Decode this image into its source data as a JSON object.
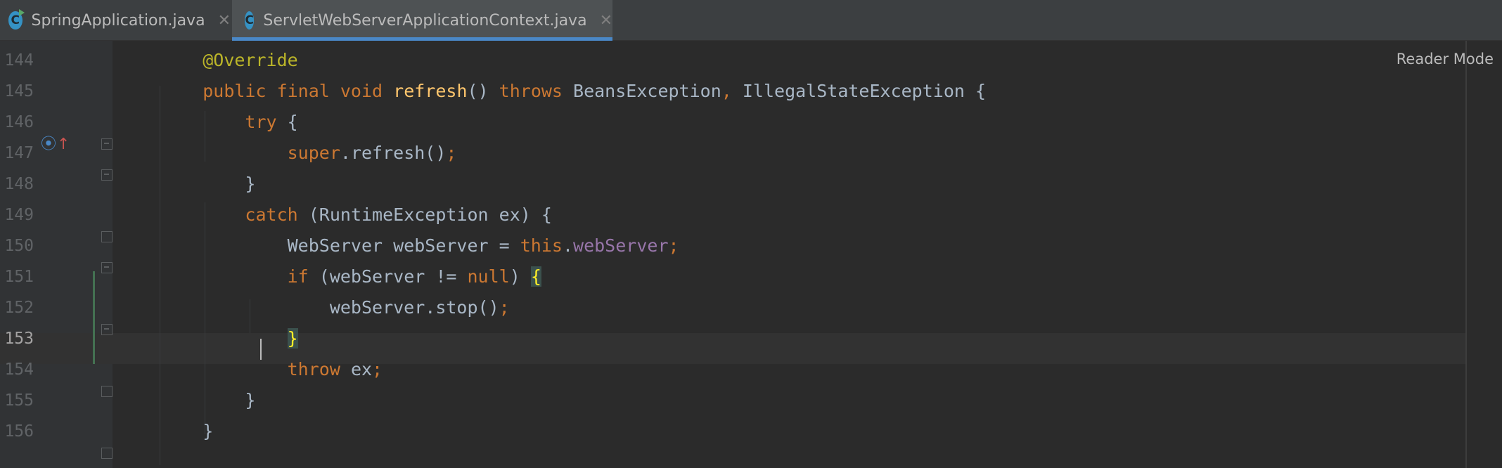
{
  "tabs": [
    {
      "label": "SpringApplication.java",
      "icon": "java-class-icon",
      "active": false
    },
    {
      "label": "ServletWebServerApplicationContext.java",
      "icon": "java-class-icon",
      "active": true
    }
  ],
  "close_glyph": "✕",
  "class_icon_letter": "C",
  "reader_mode": "Reader Mode",
  "gutter_icon": {
    "name": "overrides-method-icon",
    "glyph": "⦿",
    "arrow": "↑"
  },
  "current_line": 153,
  "colors": {
    "background": "#2b2b2b",
    "keyword": "#cc7832",
    "annotation": "#bbb529",
    "method_declaration": "#ffc66d",
    "field": "#9876aa",
    "text": "#a9b7c6",
    "tab_underline": "#4a88c7"
  },
  "lines": [
    {
      "num": "144",
      "tokens": [
        {
          "t": "    "
        },
        {
          "t": "@Override",
          "c": "ann"
        }
      ]
    },
    {
      "num": "145",
      "tokens": [
        {
          "t": "    "
        },
        {
          "t": "public final void ",
          "c": "kw"
        },
        {
          "t": "refresh",
          "c": "fn"
        },
        {
          "t": "() "
        },
        {
          "t": "throws ",
          "c": "kw"
        },
        {
          "t": "BeansException"
        },
        {
          "t": ", ",
          "c": "kw"
        },
        {
          "t": "IllegalStateException {"
        }
      ]
    },
    {
      "num": "146",
      "tokens": [
        {
          "t": "        "
        },
        {
          "t": "try ",
          "c": "kw"
        },
        {
          "t": "{"
        }
      ]
    },
    {
      "num": "147",
      "tokens": [
        {
          "t": "            "
        },
        {
          "t": "super",
          "c": "kw"
        },
        {
          "t": ".refresh()"
        },
        {
          "t": ";",
          "c": "kw"
        }
      ]
    },
    {
      "num": "148",
      "tokens": [
        {
          "t": "        }"
        }
      ]
    },
    {
      "num": "149",
      "tokens": [
        {
          "t": "        "
        },
        {
          "t": "catch ",
          "c": "kw"
        },
        {
          "t": "(RuntimeException ex) {"
        }
      ]
    },
    {
      "num": "150",
      "tokens": [
        {
          "t": "            WebServer webServer = "
        },
        {
          "t": "this",
          "c": "kw"
        },
        {
          "t": "."
        },
        {
          "t": "webServer",
          "c": "field"
        },
        {
          "t": ";",
          "c": "kw"
        }
      ]
    },
    {
      "num": "151",
      "tokens": [
        {
          "t": "            "
        },
        {
          "t": "if ",
          "c": "kw"
        },
        {
          "t": "(webServer != "
        },
        {
          "t": "null",
          "c": "kw"
        },
        {
          "t": ") "
        },
        {
          "t": "{",
          "c": "brace-hl"
        }
      ]
    },
    {
      "num": "152",
      "tokens": [
        {
          "t": "                webServer.stop()"
        },
        {
          "t": ";",
          "c": "kw"
        }
      ]
    },
    {
      "num": "153",
      "tokens": [
        {
          "t": "            "
        },
        {
          "t": "}",
          "c": "brace-hl"
        }
      ]
    },
    {
      "num": "154",
      "tokens": [
        {
          "t": "            "
        },
        {
          "t": "throw ",
          "c": "kw"
        },
        {
          "t": "ex"
        },
        {
          "t": ";",
          "c": "kw"
        }
      ]
    },
    {
      "num": "155",
      "tokens": [
        {
          "t": "        }"
        }
      ]
    },
    {
      "num": "156",
      "tokens": [
        {
          "t": "    }"
        }
      ]
    }
  ]
}
